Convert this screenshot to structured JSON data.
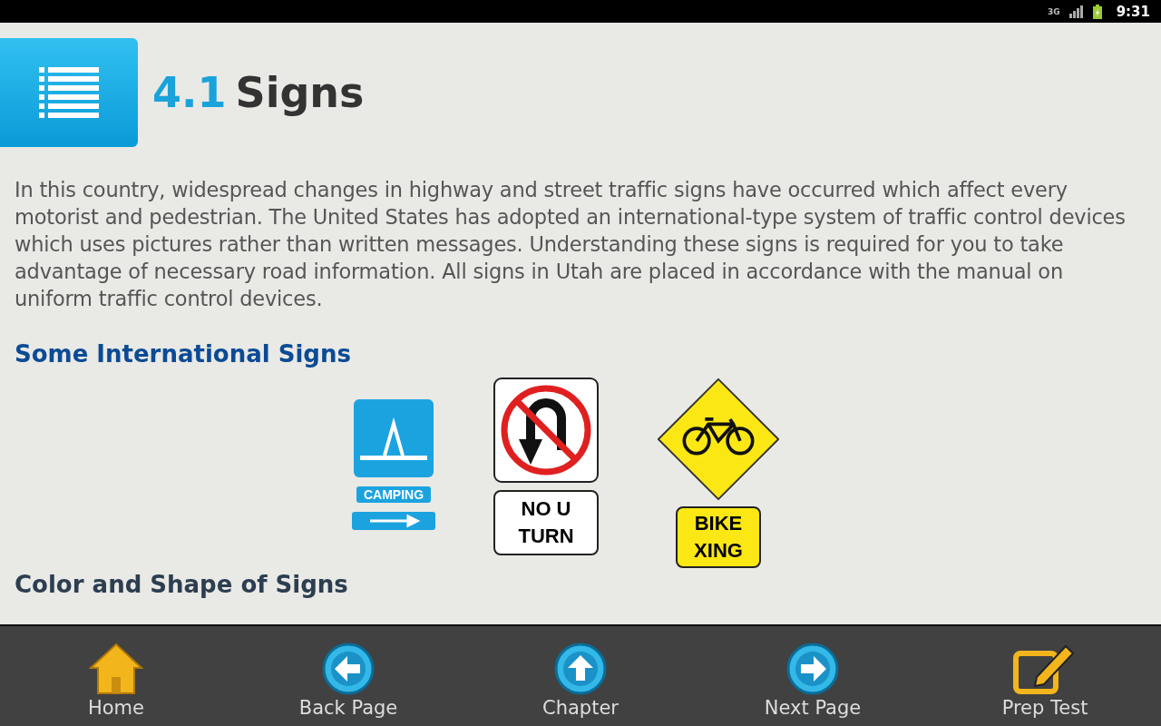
{
  "status_bar": {
    "network": "3G",
    "time": "9:31"
  },
  "header": {
    "number": "4.1",
    "title": "Signs"
  },
  "intro": "In this country, widespread changes in highway and street traffic signs have occurred which affect every motorist and pedestrian. The United States has adopted an international-type system of traffic control devices which uses pictures rather than written messages. Understanding these signs is required for you to take advantage of necessary road information. All signs in Utah are placed in accordance with the manual on uniform traffic control devices.",
  "section": {
    "heading": "Some International Signs"
  },
  "signs": [
    {
      "kind": "camping",
      "caption": [
        "CAMPING"
      ]
    },
    {
      "kind": "no_u_turn",
      "caption": [
        "NO U",
        "TURN"
      ]
    },
    {
      "kind": "bike",
      "caption": [
        "BIKE",
        "XING"
      ]
    }
  ],
  "next_section": {
    "heading": "Color and Shape of Signs"
  },
  "bottom_nav": [
    {
      "kind": "home",
      "label": "Home"
    },
    {
      "kind": "back",
      "label": "Back Page"
    },
    {
      "kind": "up",
      "label": "Chapter"
    },
    {
      "kind": "next",
      "label": "Next Page"
    },
    {
      "kind": "edit",
      "label": "Prep Test"
    }
  ]
}
